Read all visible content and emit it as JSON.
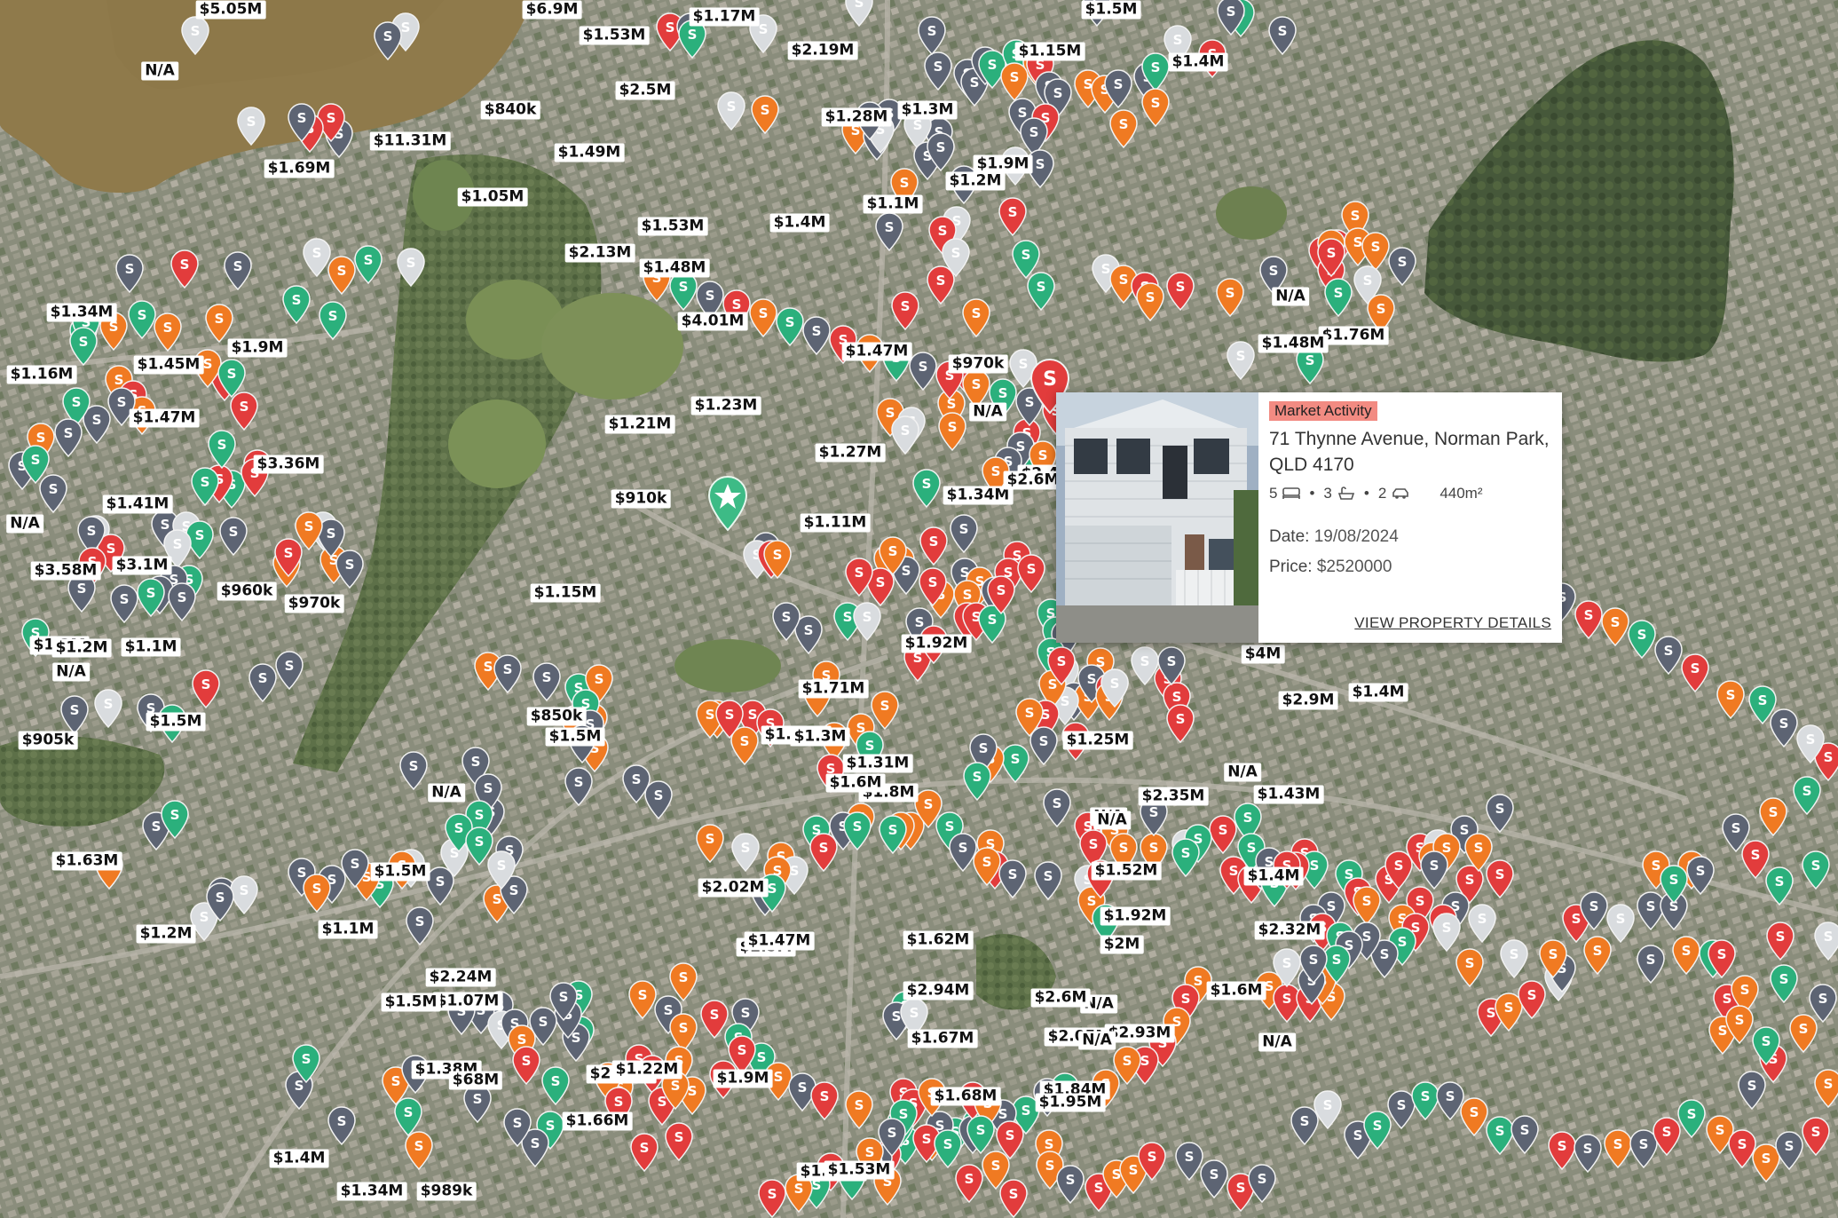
{
  "map": {
    "colors": {
      "sold_red": "#e23c3c",
      "green": "#2bb07c",
      "orange": "#f07a22",
      "slate": "#5d6473",
      "silver": "#d9dcdf",
      "river": "#8f7a4b",
      "bushland": "#3e4f2f",
      "suburb": "#8a8d7a"
    },
    "pin_glyph": "S",
    "home_marker_icon": "star-icon",
    "price_labels": [
      "$5.05M",
      "$6.9M",
      "$1.53M",
      "$1.17M",
      "N/A",
      "$2.19M",
      "$2.5M",
      "$840k",
      "$11.31M",
      "$1.69M",
      "$1.49M",
      "$1.05M",
      "$1.28M",
      "$1.3M",
      "$1.15M",
      "$1.5M",
      "$1.4M",
      "$1.2M",
      "$1.1M",
      "$1.9M",
      "$1.53M",
      "$1.4M",
      "$2.13M",
      "$1.48M",
      "$4.01M",
      "$1.47M",
      "$970k",
      "$1.21M",
      "$1.23M",
      "$1.34M",
      "$1.9M",
      "$1.16M",
      "$1.45M",
      "$1.47M",
      "$3.36M",
      "$1.41M",
      "$3.1M",
      "$960k",
      "$970k",
      "$1.15M",
      "$910k",
      "N/A",
      "$3.58M",
      "$1.3M",
      "$1.2M",
      "$1.1M",
      "$905k",
      "N/A",
      "$1.5M",
      "$1.27M",
      "$1.11M",
      "$1.34M",
      "$1.92M",
      "$1.71M",
      "$1.28M",
      "$1.3M",
      "$1.31M",
      "$1.8M",
      "$1.6M",
      "$850k",
      "$1.5M",
      "N/A",
      "$1.63M",
      "$1.2M",
      "$1.1M",
      "$1.5M",
      "$1.07M",
      "$1.5M",
      "$1.38M",
      "$2.24M",
      "$68M",
      "$2.91M",
      "$1.22M",
      "$989k",
      "$1.66M",
      "$1.4M",
      "$1.34M",
      "$2.02M",
      "$2.5M",
      "$1.62M",
      "$2.94M",
      "$1.67M",
      "$1.47M",
      "$1.41M",
      "$1.9M",
      "$1.53M",
      "$1.68M",
      "$1.84M",
      "$2.05M",
      "$2M",
      "$1.25M",
      "$4M",
      "$2.9M",
      "$1.4M",
      "$1.76M",
      "N/A",
      "$1.48M",
      "$1.43M",
      "$2.35M",
      "$1.52M",
      "$1.92M",
      "$1.6M",
      "$2.32M",
      "$2.93M",
      "N/A",
      "$1.4M",
      "N/A",
      "N/A",
      "N/A",
      "N/A",
      "N/A",
      "N/A",
      "$2.6M",
      "$1.95M",
      "$2.4M",
      "$2.6M"
    ],
    "popup": {
      "badge": "Market Activity",
      "address": "71 Thynne Avenue, Norman Park, QLD 4170",
      "beds": "5",
      "baths": "3",
      "cars": "2",
      "land": "440m²",
      "date_label": "Date:",
      "date_value": "19/08/2024",
      "price_label": "Price:",
      "price_value": "$2520000",
      "link": "VIEW PROPERTY DETAILS"
    }
  }
}
